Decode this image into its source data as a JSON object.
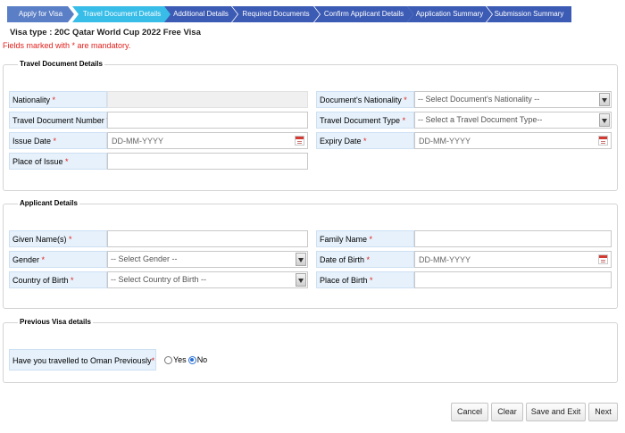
{
  "steps": [
    {
      "label": "Apply for Visa",
      "state": "done"
    },
    {
      "label": "Travel Document Details",
      "state": "active"
    },
    {
      "label": "Additional Details",
      "state": "todo"
    },
    {
      "label": "Required Documents",
      "state": "todo"
    },
    {
      "label": "Confirm Applicant Details",
      "state": "todo"
    },
    {
      "label": "Application Summary",
      "state": "todo"
    },
    {
      "label": "Submission Summary",
      "state": "todo"
    }
  ],
  "visa_type": {
    "label": "Visa type",
    "value": ": 20C Qatar World Cup 2022 Free Visa"
  },
  "mandatory_note": "Fields marked with * are mandatory.",
  "travel_document": {
    "title": "Travel Document Details",
    "nationality": {
      "label": "Nationality",
      "req": "*",
      "value": ""
    },
    "documents_nationality": {
      "label": "Document's Nationality",
      "req": "*",
      "selected": "-- Select Document's Nationality --"
    },
    "travel_document_number": {
      "label": "Travel Document Number",
      "req": "*",
      "value": ""
    },
    "travel_document_type": {
      "label": "Travel Document Type",
      "req": "*",
      "selected": "-- Select a Travel Document Type--"
    },
    "issue_date": {
      "label": "Issue Date",
      "req": "*",
      "placeholder": "DD-MM-YYYY"
    },
    "expiry_date": {
      "label": "Expiry Date",
      "req": "*",
      "placeholder": "DD-MM-YYYY"
    },
    "place_of_issue": {
      "label": "Place of Issue",
      "req": "*",
      "value": ""
    }
  },
  "applicant": {
    "title": "Applicant Details",
    "given_names": {
      "label": "Given Name(s)",
      "req": "*",
      "value": ""
    },
    "family_name": {
      "label": "Family Name",
      "req": "*",
      "value": ""
    },
    "gender": {
      "label": "Gender",
      "req": "*",
      "selected": "-- Select Gender --"
    },
    "date_of_birth": {
      "label": "Date of Birth",
      "req": "*",
      "placeholder": "DD-MM-YYYY"
    },
    "country_of_birth": {
      "label": "Country of Birth",
      "req": "*",
      "selected": "-- Select Country of Birth --"
    },
    "place_of_birth": {
      "label": "Place of Birth",
      "req": "*",
      "value": ""
    }
  },
  "previous_visa": {
    "title": "Previous Visa details",
    "question": "Have you travelled to Oman Previously",
    "req": "*",
    "options": [
      "Yes",
      "No"
    ],
    "selected": "No"
  },
  "buttons": {
    "cancel": "Cancel",
    "clear": "Clear",
    "save_exit": "Save and Exit",
    "next": "Next"
  },
  "colors": {
    "step_done": "#5b7fc6",
    "step_active": "#38bde8",
    "step_todo": "#3c5bb4",
    "required": "#e0201c",
    "label_bg": "#e6f1fb"
  }
}
